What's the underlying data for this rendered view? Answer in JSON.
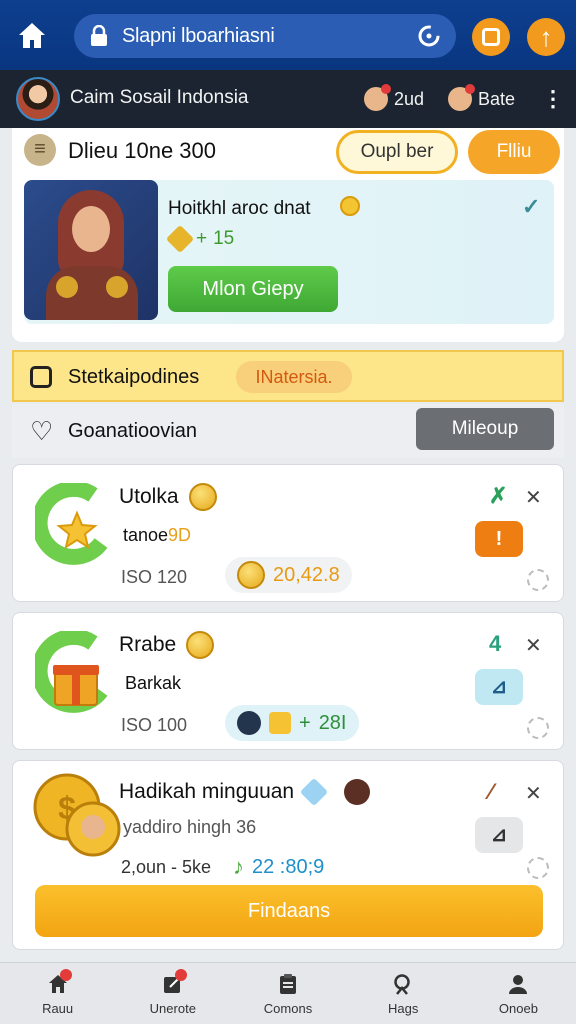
{
  "browser": {
    "url": "Slapni lboarhiasni"
  },
  "profile": {
    "name": "Caim Sosail Indonsia",
    "item1": "2ud",
    "item2": "Bate"
  },
  "header": {
    "icon": "menu-icon",
    "title": "Dlieu 10ne 300",
    "outline_button": "Oupl ber",
    "orange_button": "Flliu"
  },
  "promo": {
    "title": "Hoitkhl aroc dnat",
    "reward": "15",
    "button": "Mlon Giepy"
  },
  "banner": {
    "text": "Stetkaipodines",
    "pill": "INatersia."
  },
  "filter": {
    "text": "Goanatioovian",
    "button": "Mileoup"
  },
  "tasks": [
    {
      "title": "Utolka",
      "subtitle_main": "tanoe",
      "subtitle_highlight": "9D",
      "meta": "ISO 120",
      "value": "20,42.8",
      "mark": "✗",
      "action": "!"
    },
    {
      "title": "Rrabe",
      "subtitle_main": "Barkak",
      "subtitle_highlight": "",
      "meta": "ISO 100",
      "value": "28I",
      "mark": "4",
      "action": "⊿"
    },
    {
      "title": "Hadikah minguuan",
      "subtitle_main": "yaddiro hingh 36",
      "subtitle_highlight": "",
      "meta": "2,oun - 5ke",
      "value": "22 :80;9",
      "mark": "⁄",
      "action": "⊿"
    }
  ],
  "cta": "Findaans",
  "nav": [
    {
      "label": "Rauu",
      "icon": "home-icon",
      "badge": true
    },
    {
      "label": "Unerote",
      "icon": "edit-icon",
      "badge": true
    },
    {
      "label": "Comons",
      "icon": "clipboard-icon",
      "badge": false
    },
    {
      "label": "Hags",
      "icon": "search-icon",
      "badge": false
    },
    {
      "label": "Onoeb",
      "icon": "profile-icon",
      "badge": false
    }
  ],
  "colors": {
    "topbar": "#0d3f8f",
    "accent_orange": "#f29a1d",
    "accent_green": "#3ea834",
    "banner_yellow": "#fde58a"
  }
}
